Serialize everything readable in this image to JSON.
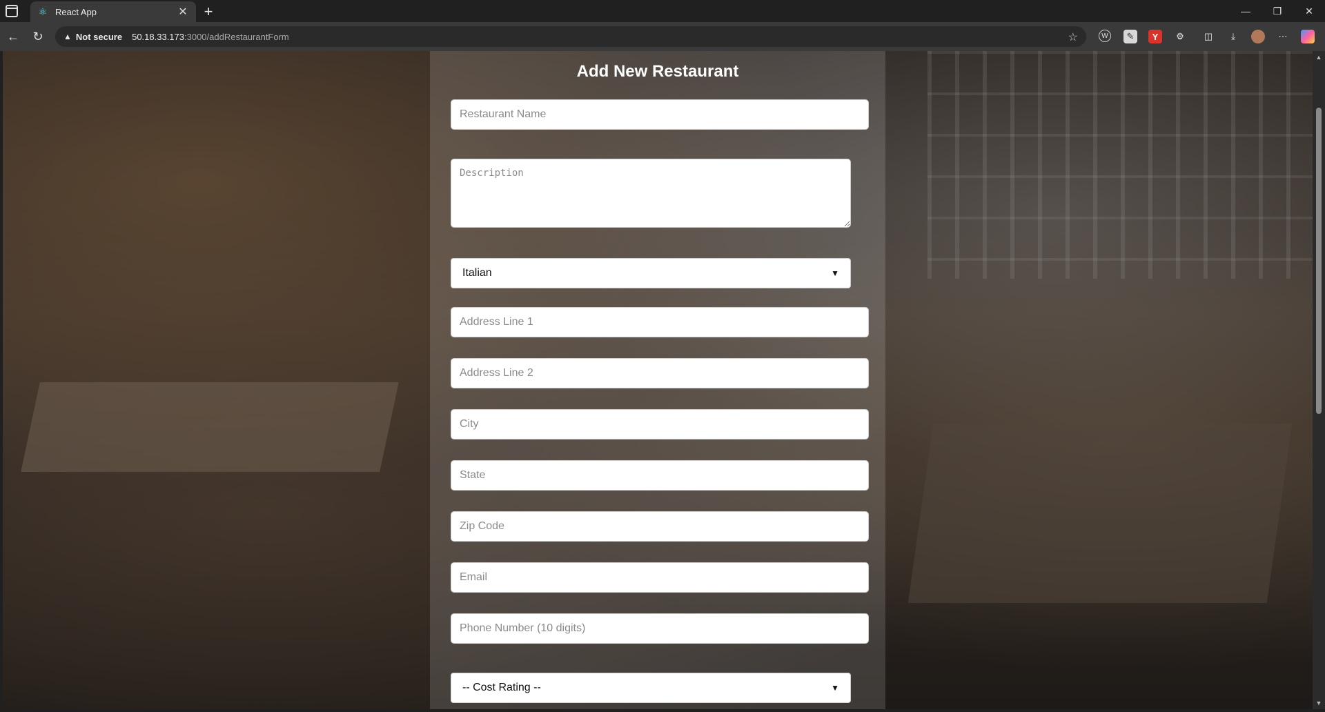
{
  "browser": {
    "tab_title": "React App",
    "security_label": "Not secure",
    "url_host": "50.18.33.173",
    "url_path": ":3000/addRestaurantForm"
  },
  "form": {
    "title": "Add New Restaurant",
    "restaurant_name_placeholder": "Restaurant Name",
    "description_placeholder": "Description",
    "cuisine_selected": "Italian",
    "address1_placeholder": "Address Line 1",
    "address2_placeholder": "Address Line 2",
    "city_placeholder": "City",
    "state_placeholder": "State",
    "zip_placeholder": "Zip Code",
    "email_placeholder": "Email",
    "phone_placeholder": "Phone Number (10 digits)",
    "cost_rating_selected": "-- Cost Rating --"
  },
  "icons": {
    "favicon": "react-icon",
    "back": "back-arrow-icon",
    "reload": "reload-icon",
    "star": "star-icon"
  }
}
